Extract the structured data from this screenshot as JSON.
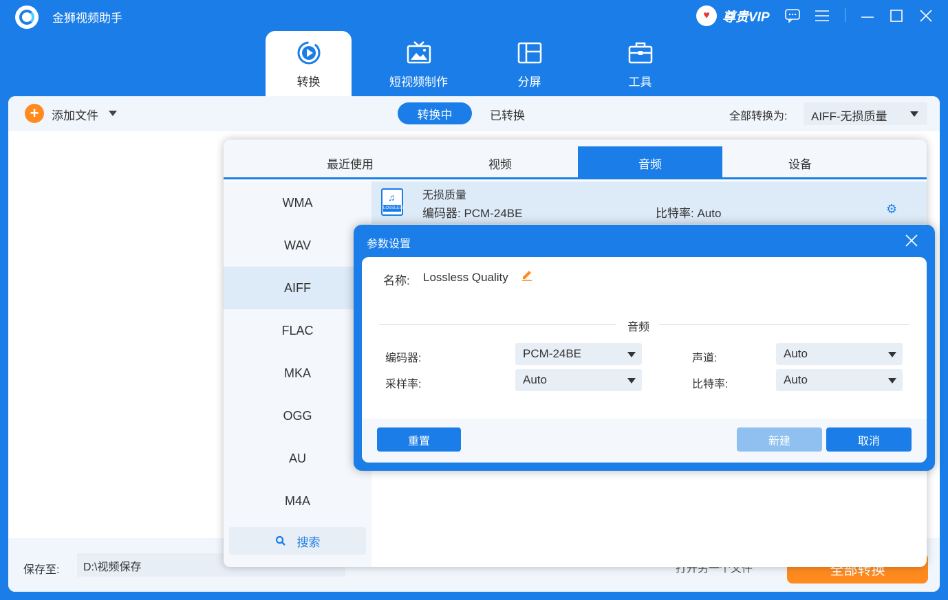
{
  "app": {
    "title": "金狮视频助手",
    "vip_label": "尊贵VIP"
  },
  "window_controls": [
    "chat-icon",
    "menu-icon",
    "minimize-icon",
    "maximize-icon",
    "close-icon"
  ],
  "nav": {
    "tabs": [
      {
        "label": "转换",
        "icon": "convert-icon",
        "active": true
      },
      {
        "label": "短视频制作",
        "icon": "tv-icon",
        "active": false
      },
      {
        "label": "分屏",
        "icon": "split-screen-icon",
        "active": false
      },
      {
        "label": "工具",
        "icon": "toolbox-icon",
        "active": false
      }
    ]
  },
  "toolbar": {
    "add_file_label": "添加文件",
    "segments": {
      "active": "转换中",
      "other": "已转换"
    },
    "convert_all_label": "全部转换为:",
    "convert_all_value": "AIFF-无损质量"
  },
  "bottom": {
    "save_label": "保存至:",
    "save_path": "D:\\视频保存",
    "open_folder_label": "打开另一个文件",
    "convert_all_button": "全部转换"
  },
  "format_popup": {
    "tabs": [
      "最近使用",
      "视频",
      "音频",
      "设备"
    ],
    "active_tab_index": 2,
    "formats": [
      "WMA",
      "WAV",
      "AIFF",
      "FLAC",
      "MKA",
      "OGG",
      "AU",
      "M4A"
    ],
    "selected_format_index": 2,
    "search_label": "搜索",
    "preset": {
      "name": "无损质量",
      "icon_tag": "LOSSLESS",
      "codec": "编码器:  PCM-24BE",
      "bitrate": "比特率:  Auto"
    }
  },
  "param_dialog": {
    "title": "参数设置",
    "name_label": "名称:",
    "name_value": "Lossless Quality",
    "section_title": "音频",
    "fields": {
      "encoder": {
        "label": "编码器:",
        "value": "PCM-24BE"
      },
      "channel": {
        "label": "声道:",
        "value": "Auto"
      },
      "sample_rate": {
        "label": "采样率:",
        "value": "Auto"
      },
      "bitrate": {
        "label": "比特率:",
        "value": "Auto"
      }
    },
    "buttons": {
      "reset": "重置",
      "new": "新建",
      "cancel": "取消"
    }
  },
  "colors": {
    "primary": "#1a7de8",
    "accent_orange": "#ff8b1f",
    "panel_bg": "#f4f7fb",
    "selected_bg": "#ddeaf8",
    "disabled_button": "#8fc0f0"
  }
}
